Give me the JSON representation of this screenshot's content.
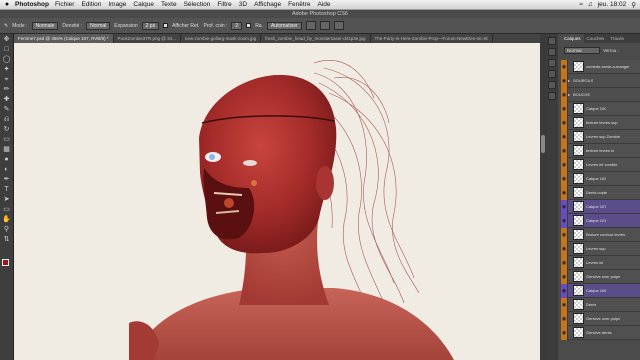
{
  "menubar": {
    "apple": "",
    "app_name": "Photoshop",
    "items": [
      "Fichier",
      "Edition",
      "Image",
      "Calque",
      "Texte",
      "Sélection",
      "Filtre",
      "3D",
      "Affichage",
      "Fenêtre",
      "Aide"
    ],
    "clock": "jeu. 18:02"
  },
  "window_title": "Adobe Photoshop CS6",
  "options": {
    "mode_label": "Mode :",
    "mode_value": "Normale",
    "density_label": "Densité :",
    "density_value": "Normal",
    "exposure_label": "Expansion",
    "size_value": "2 px",
    "show_label": "Afficher Ret.",
    "proportional_label": "Prof. coin :",
    "ratio_label": "Ra.",
    "auto_label": "Automatiser"
  },
  "tabs": [
    "Femme7.psd @ 356% (Calque 107, RVB/8) *",
    "PunkZombie3TR.png @ 34...",
    "new-zombie-gollarg-mask-zoom.jpg",
    "fresh_zombie_head_by_monstersaser-d41p3e.jpg",
    "The-Party-Is-Here-Zombie-Prop—Forum-NewEtes-Inc-8l"
  ],
  "panel": {
    "tabs": [
      "Calques",
      "Couches",
      "Tracés"
    ],
    "blend": "Normal",
    "lock_label": "Verrou :"
  },
  "layers": [
    {
      "name": "zumedo-envie-a-manger",
      "selected": false,
      "group": false
    },
    {
      "name": "SOURCILS",
      "selected": false,
      "group": true
    },
    {
      "name": "BOUCHE",
      "selected": false,
      "group": true
    },
    {
      "name": "Calque 100",
      "selected": false,
      "group": false
    },
    {
      "name": "texture levres sup",
      "selected": false,
      "group": false
    },
    {
      "name": "Levres sup Zombie",
      "selected": false,
      "group": false
    },
    {
      "name": "texture levres in",
      "selected": false,
      "group": false
    },
    {
      "name": "Levres inf zombie",
      "selected": false,
      "group": false
    },
    {
      "name": "Calque 102",
      "selected": false,
      "group": false
    },
    {
      "name": "Dents copie",
      "selected": false,
      "group": false
    },
    {
      "name": "Calque 107",
      "selected": true,
      "group": false
    },
    {
      "name": "Calque 101",
      "selected": true,
      "group": false
    },
    {
      "name": "Brulure contour levres",
      "selected": false,
      "group": false
    },
    {
      "name": "Levres sup",
      "selected": false,
      "group": false
    },
    {
      "name": "Levres inf",
      "selected": false,
      "group": false
    },
    {
      "name": "Gencive over pulpe",
      "selected": false,
      "group": false
    },
    {
      "name": "Calque 106",
      "selected": true,
      "group": false
    },
    {
      "name": "Dents",
      "selected": false,
      "group": false
    },
    {
      "name": "Gencive over pulpe",
      "selected": false,
      "group": false
    },
    {
      "name": "Gencive dents",
      "selected": false,
      "group": false
    }
  ]
}
